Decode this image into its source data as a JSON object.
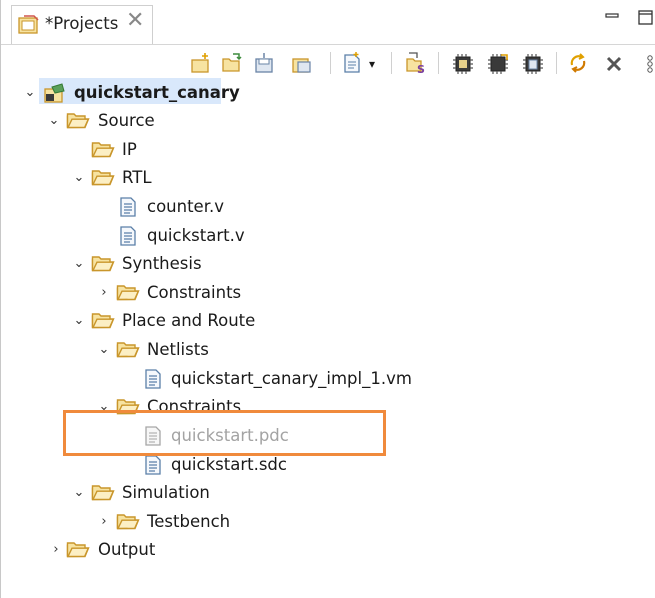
{
  "tab": {
    "title": "*Projects",
    "close": "✕"
  },
  "window_buttons": {
    "minimize": "▭",
    "maximize": "□"
  },
  "toolbar": {
    "buttons": [
      "new-file-icon",
      "open-file-icon",
      "save-icon",
      "save-all-icon",
      "new-dropdown-icon",
      "synthesis-icon",
      "chip-icon",
      "chip-run-icon",
      "chip-save-icon",
      "refresh-icon",
      "delete-icon",
      "more-icon"
    ],
    "dropdown_arrow": "▾"
  },
  "tree": {
    "root": "quickstart_canary",
    "source": "Source",
    "ip": "IP",
    "rtl": "RTL",
    "counter": "counter.v",
    "quickstart_v": "quickstart.v",
    "synthesis": "Synthesis",
    "syn_constraints": "Constraints",
    "place_route": "Place and Route",
    "netlists": "Netlists",
    "impl_vm": "quickstart_canary_impl_1.vm",
    "pr_constraints": "Constraints",
    "pdc": "quickstart.pdc",
    "sdc": "quickstart.sdc",
    "simulation": "Simulation",
    "testbench": "Testbench",
    "output": "Output"
  },
  "colors": {
    "folder_fill": "#f7e3a1",
    "folder_stroke": "#c9962b",
    "highlight": "#f08a3c",
    "selection": "#d9e8fb"
  }
}
